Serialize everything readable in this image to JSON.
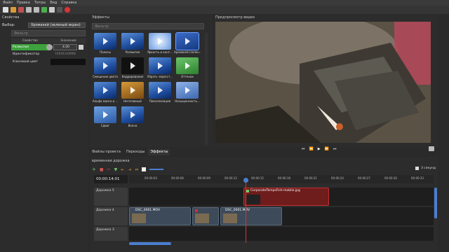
{
  "menu": [
    "Файл",
    "Правка",
    "Титры",
    "Вид",
    "Справка"
  ],
  "toolbar_icons": [
    "new-file-icon",
    "open-file-icon",
    "save-file-icon",
    "undo-icon",
    "redo-icon",
    "add-icon",
    "remove-icon",
    "record-icon"
  ],
  "properties": {
    "title": "Свойства",
    "select_label": "Выбор:",
    "select_value": "Хромакей (зеленый экран)",
    "filter_placeholder": "Фильтр",
    "col_property": "Свойство",
    "col_value": "Значение",
    "rows": [
      {
        "name": "Размытие",
        "value": "4.00"
      },
      {
        "name": "Идентификатор",
        "value": "Y4RXCAOMIN"
      },
      {
        "name": "Ключевой цвет",
        "value": ""
      }
    ]
  },
  "effects": {
    "title": "Эффекты",
    "filter_placeholder": "Фильтр",
    "items": [
      "Полосы",
      "Размытие",
      "Яркость и конт...",
      "Хромакей (зелен...",
      "Смещение цвета",
      "Кадрирование",
      "Убрать чересст...",
      "Оттенок",
      "Альфа маска и ...",
      "Негативный",
      "Пикселизация",
      "Насыщенность...",
      "Сдвиг",
      "Волна"
    ]
  },
  "preview": {
    "title": "Предпросмотр видео"
  },
  "bottom_tabs": [
    "Файлы проекта",
    "Переходы",
    "Эффекты"
  ],
  "timeline": {
    "title": "временная дорожка",
    "timecode": "00:00:14:01",
    "zoom_label": "3 секунд",
    "ruler": [
      "00:00:03",
      "00:00:06",
      "00:00:09",
      "00:00:12",
      "00:00:15",
      "00:00:18",
      "00:00:21",
      "00:00:24",
      "00:00:27",
      "00:00:30",
      "00:00:33"
    ],
    "tracks": [
      {
        "name": "Дорожка 5",
        "clips": [
          {
            "name": "CorporateTempsFish-mobile.jpg"
          }
        ]
      },
      {
        "name": "Дорожка 4",
        "clips": [
          {
            "name": "DSC_0001.MOV"
          },
          {
            "name": "DSC_0001.MOV"
          }
        ]
      },
      {
        "name": "Дорожка 3",
        "clips": []
      }
    ]
  },
  "colors": {
    "accent": "#4a7fd0",
    "playhead": "#e03030",
    "selected_clip": "#7a1f1f"
  }
}
